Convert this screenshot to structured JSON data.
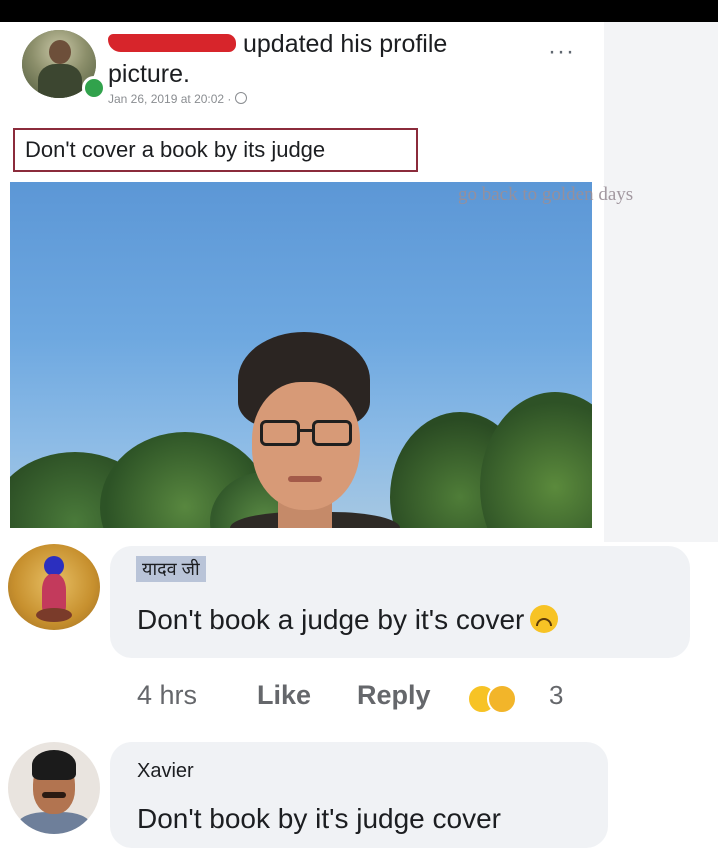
{
  "post": {
    "action_line1": "updated his profile",
    "action_line2": "picture.",
    "timestamp": "Jan 26, 2019 at 20:02 ·",
    "more_label": "···",
    "caption": "Don't cover a book by its judge",
    "watermark": "go back to golden days"
  },
  "comments": [
    {
      "author": "यादव जी",
      "text": "Don't book a judge by it's cover",
      "time": "4 hrs",
      "like_label": "Like",
      "reply_label": "Reply",
      "reaction_count": "3"
    },
    {
      "author": "Xavier",
      "text": "Don't book by it's judge cover"
    }
  ],
  "colors": {
    "online": "#31a24c",
    "redaction": "#d7252b",
    "caption_border": "#8b2b3b",
    "bubble": "#f0f2f5"
  }
}
